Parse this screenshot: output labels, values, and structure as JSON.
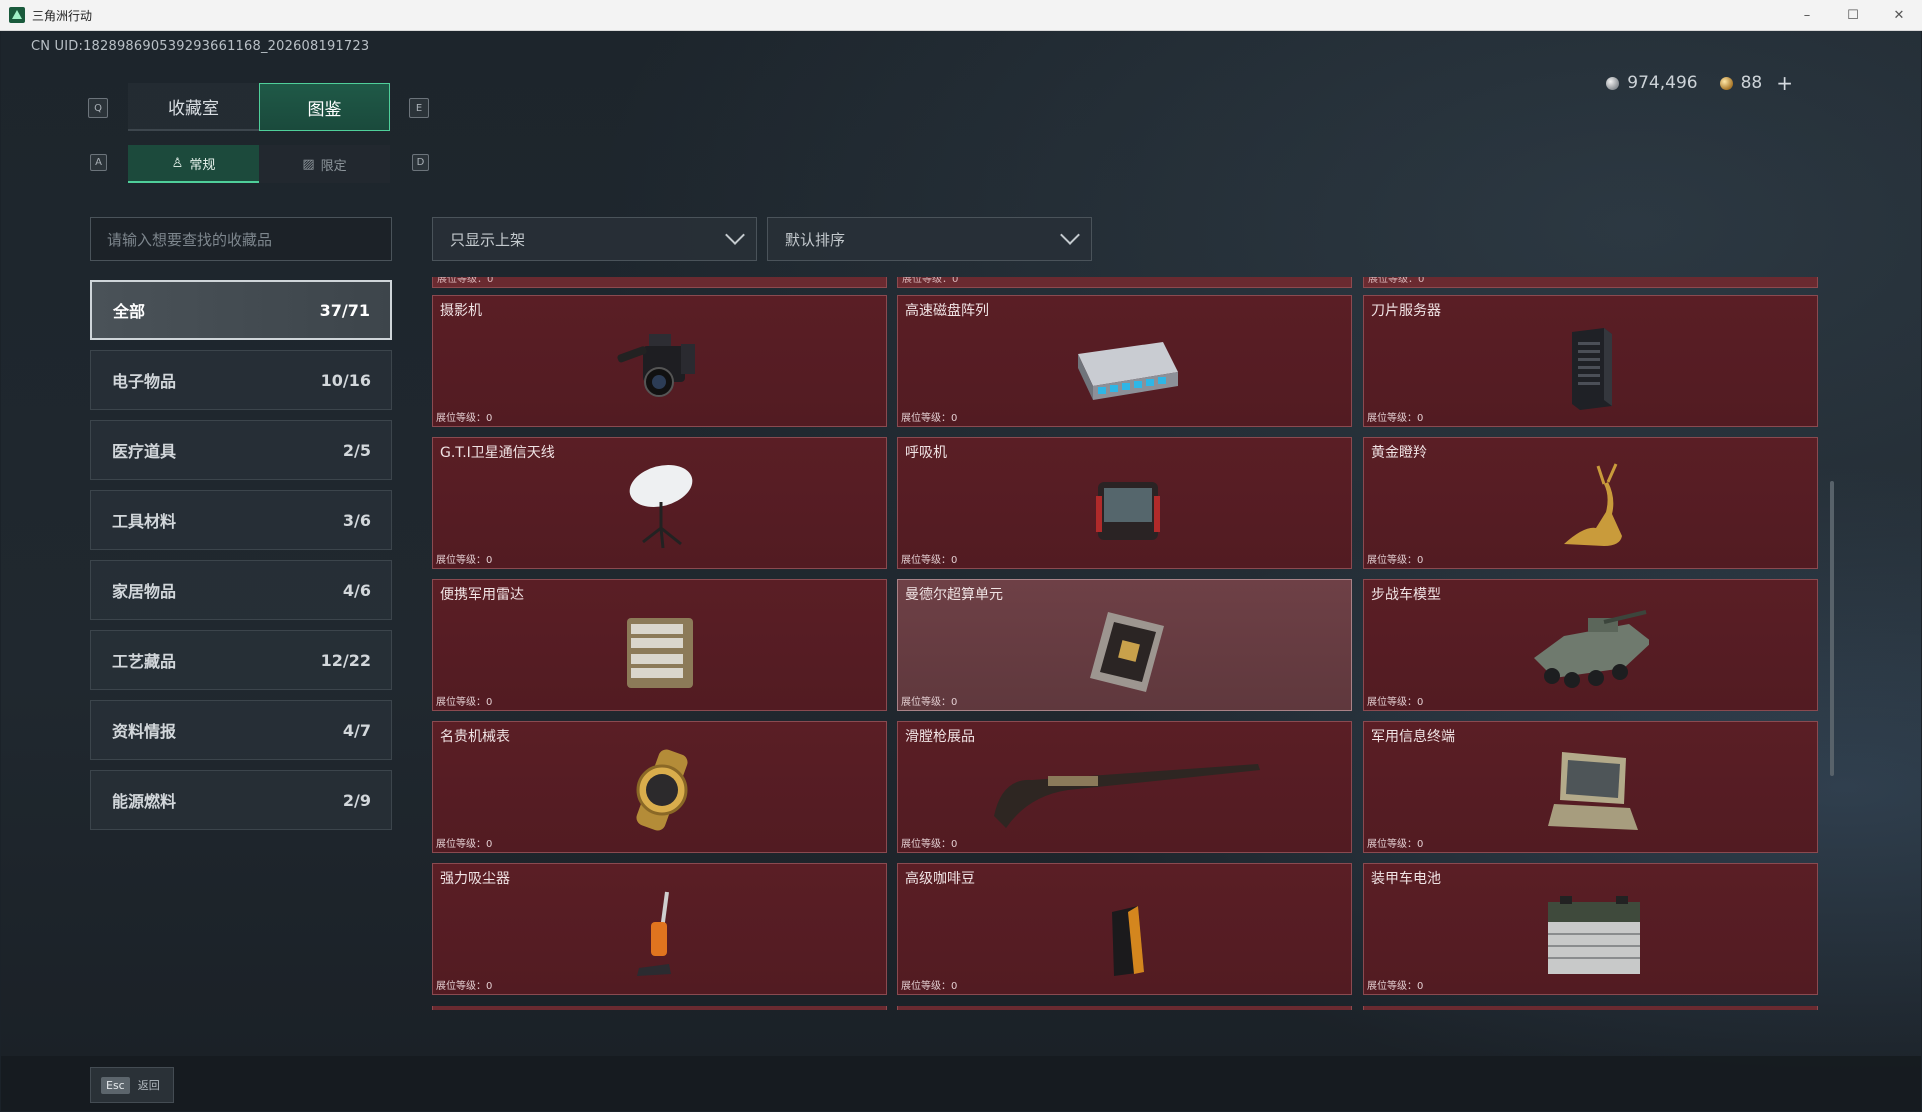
{
  "window": {
    "title": "三角洲行动",
    "minimize": "–",
    "maximize": "☐",
    "close": "✕"
  },
  "uid": "CN UID:1828986905392936611​68_202608191723",
  "currency": {
    "silver": "974,496",
    "gold": "88",
    "plus": "+"
  },
  "main_tabs": {
    "left_key": "Q",
    "right_key": "E",
    "items": [
      {
        "label": "收藏室",
        "active": false
      },
      {
        "label": "图鉴",
        "active": true
      }
    ]
  },
  "sub_tabs": {
    "left_key": "A",
    "right_key": "D",
    "items": [
      {
        "label": "常规",
        "active": true
      },
      {
        "label": "限定",
        "active": false
      }
    ]
  },
  "search": {
    "placeholder": "请输入想要查找的收藏品"
  },
  "filters": {
    "display": "只显示上架",
    "sort": "默认排序"
  },
  "categories": [
    {
      "label": "全部",
      "count": "37/71"
    },
    {
      "label": "电子物品",
      "count": "10/16"
    },
    {
      "label": "医疗道具",
      "count": "2/5"
    },
    {
      "label": "工具材料",
      "count": "3/6"
    },
    {
      "label": "家居物品",
      "count": "4/6"
    },
    {
      "label": "工艺藏品",
      "count": "12/22"
    },
    {
      "label": "资料情报",
      "count": "4/7"
    },
    {
      "label": "能源燃料",
      "count": "2/9"
    }
  ],
  "level_label": "展位等级：0",
  "items": [
    {
      "name": "摄影机",
      "icon": "camera-icon"
    },
    {
      "name": "高速磁盘阵列",
      "icon": "disk-array-icon"
    },
    {
      "name": "刀片服务器",
      "icon": "server-icon"
    },
    {
      "name": "G.T.I卫星通信天线",
      "icon": "satellite-dish-icon"
    },
    {
      "name": "呼吸机",
      "icon": "ventilator-icon"
    },
    {
      "name": "黄金瞪羚",
      "icon": "golden-gazelle-icon"
    },
    {
      "name": "便携军用雷达",
      "icon": "radar-icon"
    },
    {
      "name": "曼德尔超算单元",
      "icon": "supercomputer-unit-icon"
    },
    {
      "name": "步战车模型",
      "icon": "ifv-model-icon"
    },
    {
      "name": "名贵机械表",
      "icon": "watch-icon"
    },
    {
      "name": "滑膛枪展品",
      "icon": "musket-icon"
    },
    {
      "name": "军用信息终端",
      "icon": "terminal-icon"
    },
    {
      "name": "强力吸尘器",
      "icon": "vacuum-icon"
    },
    {
      "name": "高级咖啡豆",
      "icon": "coffee-bag-icon"
    },
    {
      "name": "装甲车电池",
      "icon": "battery-icon"
    }
  ],
  "bottom": {
    "esc_key": "Esc",
    "esc_label": "返回"
  }
}
